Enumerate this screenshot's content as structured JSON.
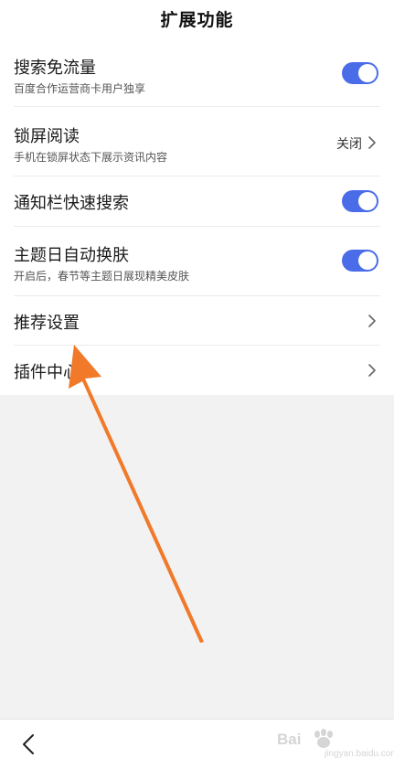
{
  "header": {
    "title": "扩展功能"
  },
  "settings": {
    "items": [
      {
        "title": "搜索免流量",
        "subtitle": "百度合作运营商卡用户独享",
        "control": "toggle",
        "on": true
      },
      {
        "title": "锁屏阅读",
        "subtitle": "手机在锁屏状态下展示资讯内容",
        "control": "value",
        "value": "关闭"
      },
      {
        "title": "通知栏快速搜索",
        "control": "toggle",
        "on": true
      },
      {
        "title": "主题日自动换肤",
        "subtitle": "开启后，春节等主题日展现精美皮肤",
        "control": "toggle",
        "on": true
      },
      {
        "title": "推荐设置",
        "control": "chevron"
      },
      {
        "title": "插件中心",
        "control": "chevron"
      }
    ]
  },
  "watermark": {
    "brand": "Bai",
    "sub": "jingyan.baidu.com"
  },
  "colors": {
    "toggle_on": "#4a6ce8",
    "annotation_arrow": "#f07a2a",
    "background": "#f2f2f2"
  },
  "icons": {
    "back": "chevron-left-icon",
    "row_arrow": "chevron-right-icon"
  }
}
